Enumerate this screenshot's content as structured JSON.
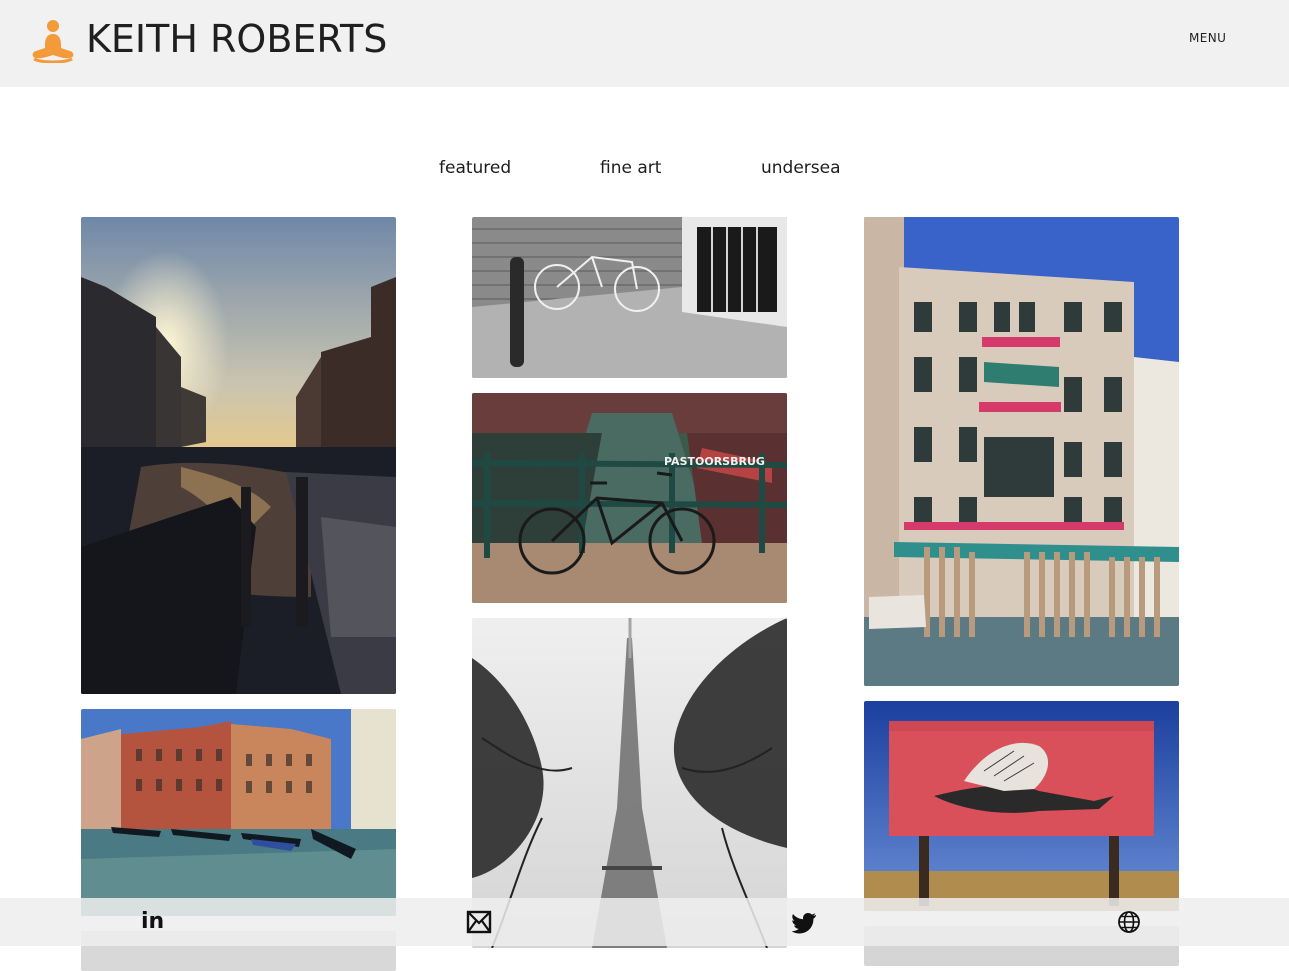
{
  "header": {
    "brand": "KEITH ROBERTS",
    "menu_label": "MENU",
    "logo_color": "#f39a3a"
  },
  "tabs": [
    {
      "label": "featured"
    },
    {
      "label": "fine art"
    },
    {
      "label": "undersea"
    }
  ],
  "photos": [
    {
      "subject": "venice-canal-sunset"
    },
    {
      "subject": "venice-palazzo-gondolas"
    },
    {
      "subject": "bicycle-brick-wall-bw"
    },
    {
      "subject": "amsterdam-bicycle-pastoorsbrug",
      "sign_text": "PASTOORSBRUG"
    },
    {
      "subject": "eiffel-tower-fog-bw"
    },
    {
      "subject": "venice-palazzo-flowers"
    },
    {
      "subject": "red-billboard-raven-hand"
    }
  ],
  "social": {
    "linkedin_text": "in",
    "icons": [
      "linkedin-icon",
      "mail-icon",
      "twitter-icon",
      "globe-icon"
    ]
  }
}
